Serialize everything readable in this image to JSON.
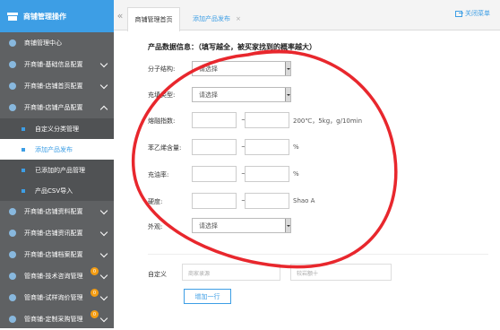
{
  "sidebar": {
    "title": "商铺管理操作",
    "items": [
      {
        "label": "商铺管理中心"
      },
      {
        "label": "开商铺-基础信息配置"
      },
      {
        "label": "开商铺-店铺首页配置"
      },
      {
        "label": "开商铺-店铺产品配置"
      },
      {
        "label": "自定义分类管理"
      },
      {
        "label": "添加产品发布"
      },
      {
        "label": "已添加的产品管理"
      },
      {
        "label": "产品CSV导入"
      },
      {
        "label": "开商铺-店铺资料配置"
      },
      {
        "label": "开商铺-店铺资讯配置"
      },
      {
        "label": "开商铺-店铺档案配置"
      },
      {
        "label": "管商铺-技术咨询管理",
        "badge": "0"
      },
      {
        "label": "管商铺-试样询价管理",
        "badge": "0"
      },
      {
        "label": "管商铺-定制采购管理",
        "badge": "0"
      }
    ]
  },
  "topbar": {
    "collapse_icon": "«",
    "tabs": [
      {
        "label": "商铺管理首页"
      },
      {
        "label": "添加产品发布",
        "close": "×"
      }
    ],
    "close_all": "关闭菜单"
  },
  "form": {
    "section_title": "产品数据信息：（填写越全，被买家找到的概率越大）",
    "fields": [
      {
        "label": "分子结构:",
        "value": "请选择"
      },
      {
        "label": "充填类型:",
        "value": "请选择"
      },
      {
        "label": "熔融指数:",
        "tilde": "~",
        "unit": "200℃，5kg，g/10min"
      },
      {
        "label": "苯乙烯含量:",
        "tilde": "~",
        "unit": "%"
      },
      {
        "label": "充油率:",
        "tilde": "~",
        "unit": "%"
      },
      {
        "label": "硬度:",
        "tilde": "~",
        "unit": "Shao A"
      },
      {
        "label": "外观:",
        "value": "请选择"
      }
    ],
    "custom": {
      "label": "自定义",
      "name_placeholder": "商家录源",
      "value_placeholder": "较岩额十",
      "add_button": "增加一行"
    }
  },
  "colors": {
    "accent": "#3d9ee5",
    "sidebar_bg": "#5f6163",
    "annotation": "#e8272d"
  }
}
